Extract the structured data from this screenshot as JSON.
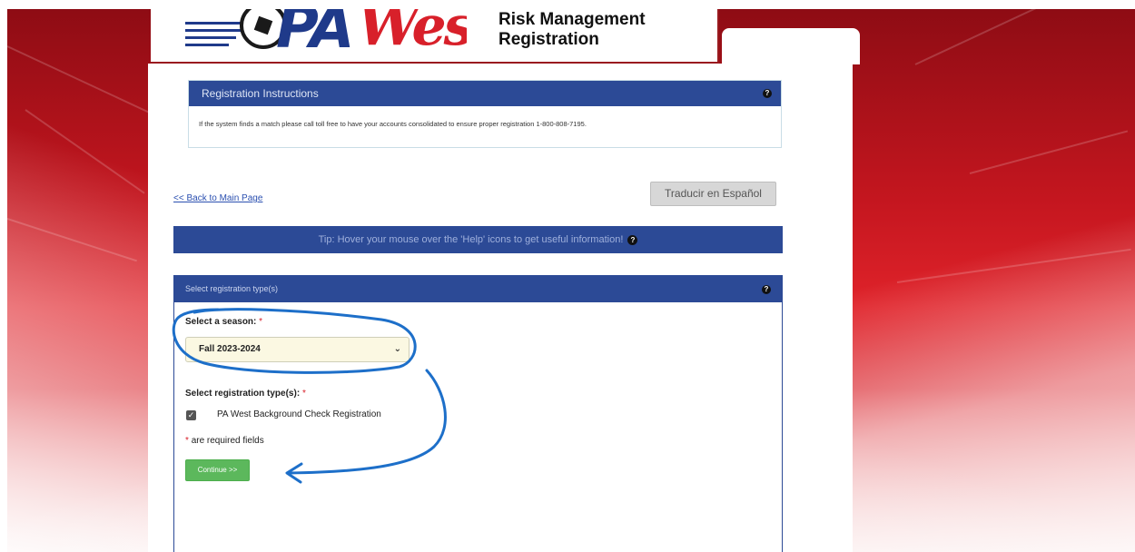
{
  "header": {
    "logo_text_pa": "PA",
    "logo_text_west": "West",
    "title_line1": "Risk Management",
    "title_line2": "Registration"
  },
  "instructions": {
    "heading": "Registration Instructions",
    "body": "If the system finds a match please call toll free to have your accounts consolidated to ensure proper registration 1-800-808-7195.",
    "help_icon": "question-circle-icon"
  },
  "nav": {
    "back_link": "<< Back to Main Page",
    "translate_button": "Traducir en Español"
  },
  "tip": {
    "text": "Tip: Hover your mouse over the 'Help' icons to get useful information!",
    "help_icon": "question-circle-icon"
  },
  "registration": {
    "heading": "Select registration type(s)",
    "season_label": "Select a season:",
    "season_selected": "Fall 2023-2024",
    "type_label": "Select registration type(s):",
    "required_marker": "*",
    "types": [
      {
        "label": "PA West Background Check Registration",
        "checked": true
      }
    ],
    "required_note": "are required fields",
    "continue_button": "Continue >>"
  },
  "colors": {
    "panel_blue": "#2c4a96",
    "brand_red": "#d8202a",
    "continue_green": "#5cb85c",
    "annotation_blue": "#1d6fc9"
  }
}
